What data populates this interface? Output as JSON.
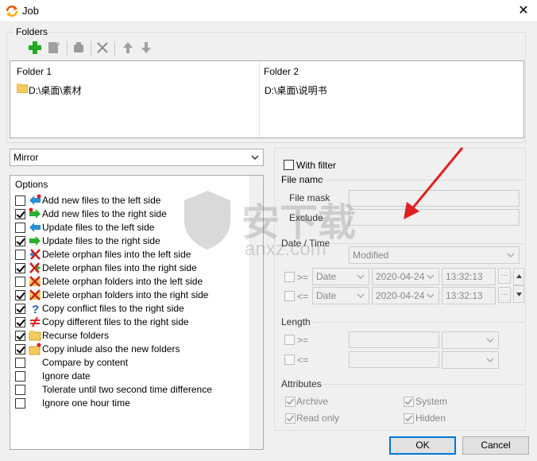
{
  "window": {
    "title": "Job",
    "close_glyph": "✕"
  },
  "folders_group": {
    "label": "Folders"
  },
  "toolbar": {
    "buttons": [
      {
        "name": "add-folder",
        "icon": "plus-icon",
        "color": "#22aa22"
      },
      {
        "name": "edit-folder",
        "icon": "edit-icon"
      },
      {
        "name": "copy-folder",
        "icon": "copy-icon"
      },
      {
        "name": "delete-folder",
        "icon": "delete-icon"
      },
      {
        "name": "move-up",
        "icon": "arrow-up-icon"
      },
      {
        "name": "move-down",
        "icon": "arrow-down-icon"
      }
    ]
  },
  "folder_list": {
    "columns": [
      "Folder 1",
      "Folder 2"
    ],
    "rows": [
      {
        "folder1": "D:\\桌面\\素材",
        "folder2": "D:\\桌面\\说明书"
      }
    ]
  },
  "mode_select": {
    "value": "Mirror"
  },
  "options": {
    "label": "Options",
    "items": [
      {
        "label": "Add new files to the left side",
        "checked": false,
        "icon": "arrow-left-new-icon"
      },
      {
        "label": "Add new files to the right side",
        "checked": true,
        "icon": "arrow-right-new-icon"
      },
      {
        "label": "Update files to the left side",
        "checked": false,
        "icon": "arrow-left-icon"
      },
      {
        "label": "Update files to the right side",
        "checked": true,
        "icon": "arrow-right-icon"
      },
      {
        "label": "Delete orphan files into the left side",
        "checked": false,
        "icon": "delete-left-icon"
      },
      {
        "label": "Delete orphan files into the right side",
        "checked": true,
        "icon": "delete-right-icon"
      },
      {
        "label": "Delete orphan folders into the left side",
        "checked": false,
        "icon": "delete-folder-left-icon"
      },
      {
        "label": "Delete orphan folders into the right side",
        "checked": true,
        "icon": "delete-folder-right-icon"
      },
      {
        "label": "Copy conflict files to the right side",
        "checked": true,
        "icon": "question-icon"
      },
      {
        "label": "Copy different files to the right side",
        "checked": true,
        "icon": "not-equal-icon"
      },
      {
        "label": "Recurse folders",
        "checked": true,
        "icon": "folder-icon"
      },
      {
        "label": "Copy inlude also the new folders",
        "checked": true,
        "icon": "new-folder-icon"
      },
      {
        "label": "Compare by content",
        "checked": false,
        "icon": ""
      },
      {
        "label": "Ignore date",
        "checked": false,
        "icon": ""
      },
      {
        "label": "Tolerate until two second time difference",
        "checked": false,
        "icon": ""
      },
      {
        "label": "Ignore one hour time",
        "checked": false,
        "icon": ""
      }
    ]
  },
  "filter": {
    "with_filter_label": "With filter",
    "with_filter_checked": false,
    "file_name": {
      "label": "File name",
      "mask_label": "File mask",
      "exclude_label": "Exclude"
    },
    "date_time": {
      "label": "Date / Time",
      "mode_value": "Modified",
      "rows": [
        {
          "op": ">=",
          "type": "Date",
          "date": "2020-04-24",
          "time": "13:32:13"
        },
        {
          "op": "<=",
          "type": "Date",
          "date": "2020-04-24",
          "time": "13:32:13"
        }
      ],
      "ellipsis": "..."
    },
    "length": {
      "label": "Length",
      "ops": [
        ">=",
        "<="
      ]
    },
    "attributes": {
      "label": "Attributes",
      "items": [
        {
          "label": "Archive",
          "checked": true
        },
        {
          "label": "System",
          "checked": true
        },
        {
          "label": "Read only",
          "checked": true
        },
        {
          "label": "Hidden",
          "checked": true
        }
      ]
    }
  },
  "buttons": {
    "ok": "OK",
    "cancel": "Cancel"
  },
  "watermark": {
    "cn": "安下载",
    "en": "anxz.com"
  },
  "colors": {
    "accent": "#0078d7",
    "annotation_arrow": "#e02020"
  }
}
